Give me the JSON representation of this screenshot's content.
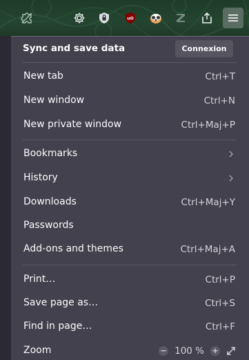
{
  "toolbar": {
    "icons": [
      "extensions-puzzle-icon",
      "settings-gear-icon",
      "password-lock-icon",
      "ublock-origin-icon",
      "privacy-badger-icon",
      "z-extension-icon",
      "share-icon",
      "hamburger-menu-icon"
    ]
  },
  "menu": {
    "sync": {
      "title": "Sync and save data",
      "button_label": "Connexion"
    },
    "groups": [
      [
        {
          "label": "New tab",
          "shortcut": "Ctrl+T"
        },
        {
          "label": "New window",
          "shortcut": "Ctrl+N"
        },
        {
          "label": "New private window",
          "shortcut": "Ctrl+Maj+P"
        }
      ],
      [
        {
          "label": "Bookmarks",
          "submenu": true
        },
        {
          "label": "History",
          "submenu": true
        },
        {
          "label": "Downloads",
          "shortcut": "Ctrl+Maj+Y"
        },
        {
          "label": "Passwords"
        },
        {
          "label": "Add-ons and themes",
          "shortcut": "Ctrl+Maj+A"
        }
      ],
      [
        {
          "label": "Print…",
          "shortcut": "Ctrl+P"
        },
        {
          "label": "Save page as…",
          "shortcut": "Ctrl+S"
        },
        {
          "label": "Find in page…",
          "shortcut": "Ctrl+F"
        }
      ]
    ],
    "zoom": {
      "label": "Zoom",
      "decrease": "−",
      "value": "100 %",
      "increase": "+",
      "fullscreen_icon": "fullscreen-expand-icon"
    }
  },
  "colors": {
    "menu_bg": "#42414d",
    "toolbar_bg": "#24452f",
    "text": "#fbfbfe",
    "shortcut_text": "#d4d3d9",
    "ublock_red": "#800000"
  }
}
